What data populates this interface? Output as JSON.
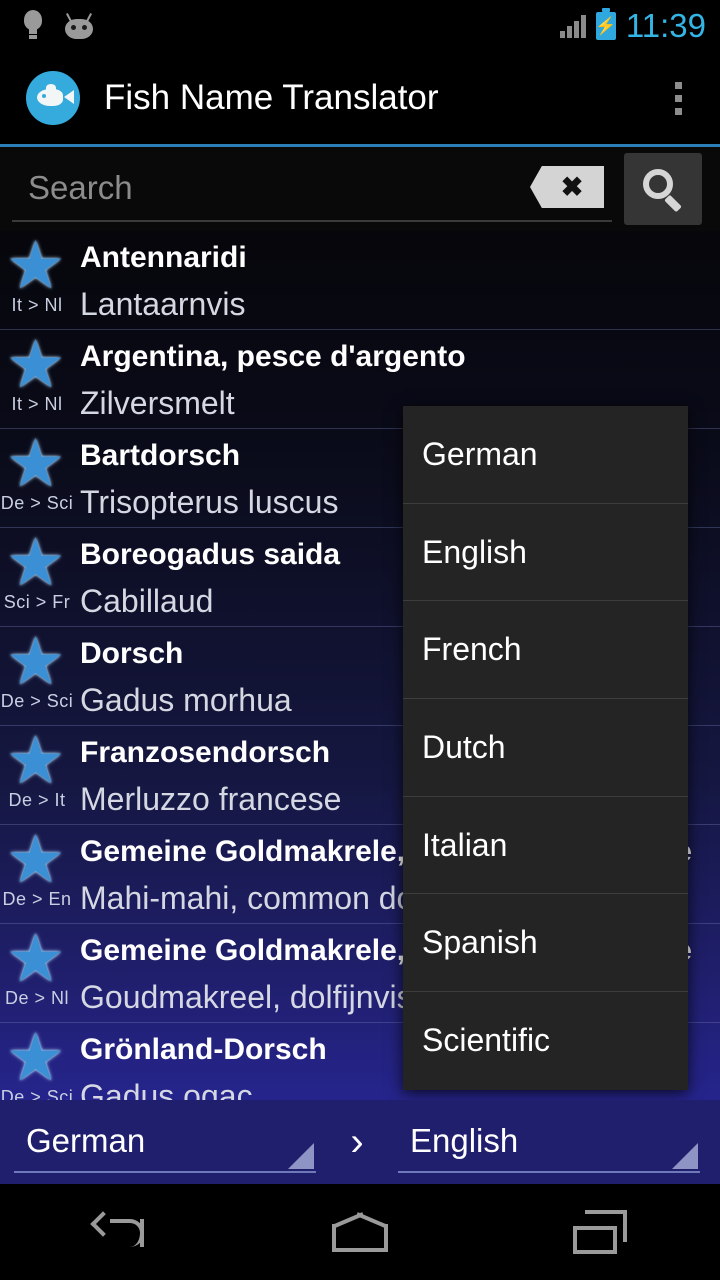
{
  "statusbar": {
    "time": "11:39",
    "icons": [
      "bulb-icon",
      "android-head-icon",
      "signal-icon",
      "battery-charging-icon"
    ]
  },
  "actionbar": {
    "title": "Fish Name Translator",
    "app_icon": "fish-icon",
    "overflow_icon": "overflow-menu-icon",
    "accent": "#2a7fb8"
  },
  "search": {
    "placeholder": "Search",
    "value": "",
    "clear_icon": "clear-backspace-icon",
    "search_icon": "search-icon"
  },
  "list": {
    "rows": [
      {
        "term": "Antennaridi",
        "translation": "Lantaarnvis",
        "pair": "It > Nl",
        "star": "★"
      },
      {
        "term": "Argentina, pesce d'argento",
        "translation": "Zilversmelt",
        "pair": "It > Nl",
        "star": "★"
      },
      {
        "term": "Bartdorsch",
        "translation": "Trisopterus luscus",
        "pair": "De > Sci",
        "star": "★"
      },
      {
        "term": "Boreogadus saida",
        "translation": "Cabillaud",
        "pair": "Sci > Fr",
        "star": "★"
      },
      {
        "term": "Dorsch",
        "translation": "Gadus morhua",
        "pair": "De > Sci",
        "star": "★"
      },
      {
        "term": "Franzosendorsch",
        "translation": "Merluzzo francese",
        "pair": "De > It",
        "star": "★"
      },
      {
        "term": "Gemeine Goldmakrele, Große Goldmakrele",
        "translation": "Mahi-mahi, common dolphinfish",
        "pair": "De > En",
        "star": "★"
      },
      {
        "term": "Gemeine Goldmakrele, Große Goldmakrele",
        "translation": "Goudmakreel, dolfijnvis",
        "pair": "De > Nl",
        "star": "★"
      },
      {
        "term": "Grönland-Dorsch",
        "translation": "Gadus ogac",
        "pair": "De > Sci",
        "star": "★"
      }
    ]
  },
  "dropdown": {
    "visible": true,
    "options": [
      {
        "label": "German"
      },
      {
        "label": "English"
      },
      {
        "label": "French"
      },
      {
        "label": "Dutch"
      },
      {
        "label": "Italian"
      },
      {
        "label": "Spanish"
      },
      {
        "label": "Scientific"
      }
    ]
  },
  "langbar": {
    "source": "German",
    "target": "English",
    "separator": "›",
    "dropdown_icon": "spinner-triangle-icon",
    "background": "#201f6e"
  },
  "navbar": {
    "back": "back-icon",
    "home": "home-icon",
    "recents": "recents-icon"
  }
}
